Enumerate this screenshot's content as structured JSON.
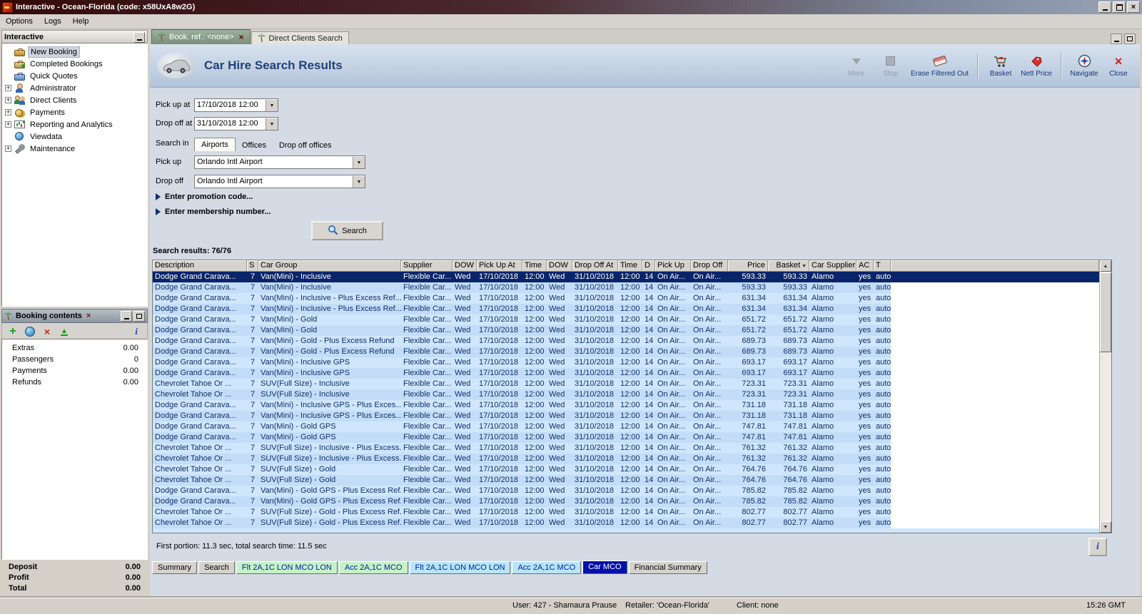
{
  "titlebar": {
    "title": "Interactive - Ocean-Florida (code: x58UxA8w2G)"
  },
  "menubar": {
    "items": [
      "Options",
      "Logs",
      "Help"
    ]
  },
  "sidebar": {
    "title": "Interactive",
    "items": [
      {
        "label": "New Booking",
        "icon": "booking",
        "expandable": false,
        "selected": true
      },
      {
        "label": "Completed Bookings",
        "icon": "completed",
        "expandable": false
      },
      {
        "label": "Quick Quotes",
        "icon": "quotes",
        "expandable": false
      },
      {
        "label": "Administrator",
        "icon": "admin",
        "expandable": true
      },
      {
        "label": "Direct Clients",
        "icon": "clients",
        "expandable": true
      },
      {
        "label": "Payments",
        "icon": "payments",
        "expandable": true
      },
      {
        "label": "Reporting and Analytics",
        "icon": "reporting",
        "expandable": true
      },
      {
        "label": "Viewdata",
        "icon": "viewdata",
        "expandable": false
      },
      {
        "label": "Maintenance",
        "icon": "maintenance",
        "expandable": true
      }
    ]
  },
  "booking_contents": {
    "title": "Booking contents",
    "items": [
      {
        "label": "Extras",
        "value": "0.00"
      },
      {
        "label": "Passengers",
        "value": "0"
      },
      {
        "label": "Payments",
        "value": "0.00"
      },
      {
        "label": "Refunds",
        "value": "0.00"
      }
    ],
    "totals": [
      {
        "label": "Deposit",
        "value": "0.00"
      },
      {
        "label": "Profit",
        "value": "0.00"
      },
      {
        "label": "Total",
        "value": "0.00"
      }
    ]
  },
  "doc_tabs": [
    {
      "label": "Book. ref.: <none>",
      "active": true
    },
    {
      "label": "Direct Clients Search",
      "active": false
    }
  ],
  "page": {
    "title": "Car Hire Search Results",
    "toolbar": [
      {
        "label": "More",
        "icon": "more",
        "disabled": true
      },
      {
        "label": "Stop",
        "icon": "stop",
        "disabled": true
      },
      {
        "label": "Erase Filtered Out",
        "icon": "eraser",
        "group_end": true
      },
      {
        "label": "Basket",
        "icon": "basket"
      },
      {
        "label": "Nett Price",
        "icon": "nett-price",
        "group_end": true
      },
      {
        "label": "Navigate",
        "icon": "navigate"
      },
      {
        "label": "Close",
        "icon": "close"
      }
    ]
  },
  "search_form": {
    "pickup_at": {
      "label": "Pick up at",
      "value": "17/10/2018 12:00"
    },
    "dropoff_at": {
      "label": "Drop off at",
      "value": "31/10/2018 12:00"
    },
    "search_in": {
      "label": "Search in",
      "tabs": [
        "Airports",
        "Offices",
        "Drop off offices"
      ],
      "active": "Airports"
    },
    "pickup": {
      "label": "Pick up",
      "value": "Orlando Intl Airport"
    },
    "dropoff": {
      "label": "Drop off",
      "value": "Orlando Intl Airport"
    },
    "promo": "Enter promotion code...",
    "membership": "Enter membership number...",
    "search_button": "Search",
    "results_label": "Search results: 76/76"
  },
  "results": {
    "columns": [
      "Description",
      "S",
      "Car Group",
      "Supplier",
      "DOW",
      "Pick Up At",
      "Time",
      "DOW",
      "Drop Off At",
      "Time",
      "D",
      "Pick Up",
      "Drop Off",
      "Price",
      "Basket",
      "Car Supplier",
      "AC",
      "T"
    ],
    "defaults": {
      "seats": "7",
      "supplier": "Flexible Car...",
      "dow1": "Wed",
      "pickup_at": "17/10/2018",
      "time1": "12:00",
      "dow2": "Wed",
      "dropoff_at": "31/10/2018",
      "time2": "12:00",
      "days": "14",
      "pickup": "On Air...",
      "dropoff": "On Air...",
      "car_supplier": "Alamo",
      "ac": "yes",
      "t": "auto"
    },
    "rows": [
      {
        "description": "Dodge Grand Carava...",
        "car_group": "Van(Mini) - Inclusive",
        "price": "593.33",
        "basket": "593.33",
        "selected": true
      },
      {
        "description": "Dodge Grand Carava...",
        "car_group": "Van(Mini) - Inclusive",
        "price": "593.33",
        "basket": "593.33"
      },
      {
        "description": "Dodge Grand Carava...",
        "car_group": "Van(Mini) - Inclusive - Plus Excess Ref...",
        "price": "631.34",
        "basket": "631.34"
      },
      {
        "description": "Dodge Grand Carava...",
        "car_group": "Van(Mini) - Inclusive - Plus Excess Ref...",
        "price": "631.34",
        "basket": "631.34"
      },
      {
        "description": "Dodge Grand Carava...",
        "car_group": "Van(Mini) - Gold",
        "price": "651.72",
        "basket": "651.72"
      },
      {
        "description": "Dodge Grand Carava...",
        "car_group": "Van(Mini) - Gold",
        "price": "651.72",
        "basket": "651.72"
      },
      {
        "description": "Dodge Grand Carava...",
        "car_group": "Van(Mini) - Gold - Plus Excess Refund",
        "price": "689.73",
        "basket": "689.73"
      },
      {
        "description": "Dodge Grand Carava...",
        "car_group": "Van(Mini) - Gold - Plus Excess Refund",
        "price": "689.73",
        "basket": "689.73"
      },
      {
        "description": "Dodge Grand Carava...",
        "car_group": "Van(Mini) - Inclusive GPS",
        "price": "693.17",
        "basket": "693.17"
      },
      {
        "description": "Dodge Grand Carava...",
        "car_group": "Van(Mini) - Inclusive GPS",
        "price": "693.17",
        "basket": "693.17"
      },
      {
        "description": "Chevrolet Tahoe Or ...",
        "car_group": "SUV(Full Size) - Inclusive",
        "price": "723.31",
        "basket": "723.31"
      },
      {
        "description": "Chevrolet Tahoe Or ...",
        "car_group": "SUV(Full Size) - Inclusive",
        "price": "723.31",
        "basket": "723.31"
      },
      {
        "description": "Dodge Grand Carava...",
        "car_group": "Van(Mini) - Inclusive GPS - Plus Exces...",
        "price": "731.18",
        "basket": "731.18"
      },
      {
        "description": "Dodge Grand Carava...",
        "car_group": "Van(Mini) - Inclusive GPS - Plus Exces...",
        "price": "731.18",
        "basket": "731.18"
      },
      {
        "description": "Dodge Grand Carava...",
        "car_group": "Van(Mini) - Gold GPS",
        "price": "747.81",
        "basket": "747.81"
      },
      {
        "description": "Dodge Grand Carava...",
        "car_group": "Van(Mini) - Gold GPS",
        "price": "747.81",
        "basket": "747.81"
      },
      {
        "description": "Chevrolet Tahoe Or ...",
        "car_group": "SUV(Full Size) - Inclusive - Plus Excess...",
        "price": "761.32",
        "basket": "761.32"
      },
      {
        "description": "Chevrolet Tahoe Or ...",
        "car_group": "SUV(Full Size) - Inclusive - Plus Excess...",
        "price": "761.32",
        "basket": "761.32"
      },
      {
        "description": "Chevrolet Tahoe Or ...",
        "car_group": "SUV(Full Size) - Gold",
        "price": "764.76",
        "basket": "764.76"
      },
      {
        "description": "Chevrolet Tahoe Or ...",
        "car_group": "SUV(Full Size) - Gold",
        "price": "764.76",
        "basket": "764.76"
      },
      {
        "description": "Dodge Grand Carava...",
        "car_group": "Van(Mini) - Gold GPS - Plus Excess Ref...",
        "price": "785.82",
        "basket": "785.82"
      },
      {
        "description": "Dodge Grand Carava...",
        "car_group": "Van(Mini) - Gold GPS - Plus Excess Ref...",
        "price": "785.82",
        "basket": "785.82"
      },
      {
        "description": "Chevrolet Tahoe Or ...",
        "car_group": "SUV(Full Size) - Gold - Plus Excess Ref...",
        "price": "802.77",
        "basket": "802.77"
      },
      {
        "description": "Chevrolet Tahoe Or ...",
        "car_group": "SUV(Full Size) - Gold - Plus Excess Ref...",
        "price": "802.77",
        "basket": "802.77"
      }
    ],
    "timing": "First portion: 11.3 sec, total search time: 11.5 sec"
  },
  "bottom_tabs": [
    {
      "label": "Summary",
      "style": "plain"
    },
    {
      "label": "Search",
      "style": "plain"
    },
    {
      "label": "Flt 2A,1C LON MCO LON",
      "style": "green"
    },
    {
      "label": "Acc 2A,1C MCO",
      "style": "green"
    },
    {
      "label": "Flt 2A,1C LON MCO LON",
      "style": "blue"
    },
    {
      "label": "Acc 2A,1C MCO",
      "style": "blue"
    },
    {
      "label": "Car MCO",
      "style": "active"
    },
    {
      "label": "Financial Summary",
      "style": "plain"
    }
  ],
  "statusbar": {
    "user": "User: 427 - Shamaura Prause",
    "retailer": "Retailer: 'Ocean-Florida'",
    "client": "Client: none",
    "time": "15:26 GMT"
  }
}
